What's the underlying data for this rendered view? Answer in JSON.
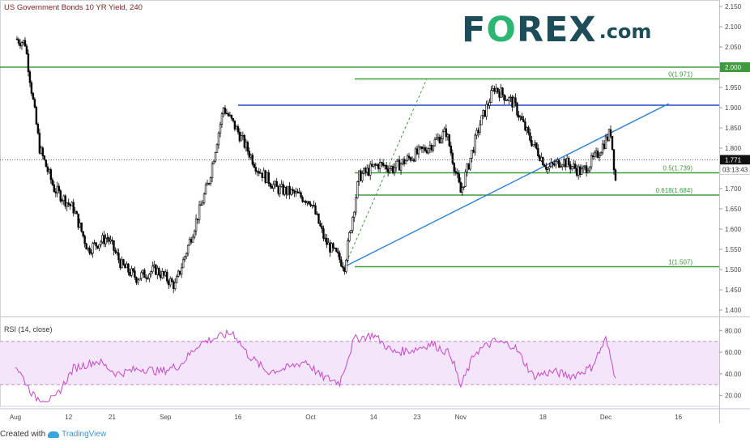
{
  "header": {
    "title": "US Government Bonds 10 YR Yield, 240",
    "logo_text_a": "F",
    "logo_text_o": "O",
    "logo_text_b": "REX",
    "logo_suffix": ".com"
  },
  "footer": {
    "created_with": "Created with",
    "brand": "TradingView"
  },
  "colors": {
    "candle": "#000000",
    "green_line": "#3d9a3d",
    "blue_line": "#2244cc",
    "trend_line": "#2a7fd4",
    "rsi_line": "#cc44cc",
    "rsi_band": "#f3e6fb",
    "rsi_dash": "#c98ccb"
  },
  "chart_data": [
    {
      "type": "candlestick",
      "title": "US Government Bonds 10 YR Yield, 240",
      "ylim": [
        1.39,
        2.15
      ],
      "y_ticks": [
        "2.150",
        "2.100",
        "2.050",
        "2.000",
        "1.950",
        "1.900",
        "1.850",
        "1.800",
        "1.750",
        "1.700",
        "1.650",
        "1.600",
        "1.550",
        "1.500",
        "1.450",
        "1.400"
      ],
      "x_ticks": [
        "Aug",
        "12",
        "21",
        "Sep",
        "16",
        "Oct",
        "14",
        "23",
        "Nov",
        "18",
        "Dec",
        "16"
      ],
      "current_price": "1.771",
      "countdown": "03:13:43",
      "horizontal_levels": [
        {
          "value": 2.0,
          "label": "2.000"
        },
        {
          "value": 1.906
        },
        {
          "value": 1.971,
          "label": "0(1.971)"
        },
        {
          "value": 1.739,
          "label": "0.5(1.739)"
        },
        {
          "value": 1.684,
          "label": "0.618(1.684)"
        },
        {
          "value": 1.507,
          "label": "1(1.507)"
        }
      ],
      "trendline": {
        "from": [
          "Oct 8",
          1.507
        ],
        "to": [
          "Dec 14",
          1.91
        ]
      },
      "approx_path": [
        [
          "Aug 1",
          2.07
        ],
        [
          "Aug 3",
          2.06
        ],
        [
          "Aug 6",
          1.8
        ],
        [
          "Aug 9",
          1.7
        ],
        [
          "Aug 13",
          1.65
        ],
        [
          "Aug 16",
          1.55
        ],
        [
          "Aug 20",
          1.58
        ],
        [
          "Aug 23",
          1.51
        ],
        [
          "Aug 26",
          1.48
        ],
        [
          "Aug 30",
          1.5
        ],
        [
          "Sep 3",
          1.46
        ],
        [
          "Sep 6",
          1.57
        ],
        [
          "Sep 10",
          1.72
        ],
        [
          "Sep 13",
          1.9
        ],
        [
          "Sep 16",
          1.84
        ],
        [
          "Sep 20",
          1.75
        ],
        [
          "Sep 24",
          1.7
        ],
        [
          "Sep 27",
          1.69
        ],
        [
          "Oct 1",
          1.67
        ],
        [
          "Oct 4",
          1.57
        ],
        [
          "Oct 8",
          1.51
        ],
        [
          "Oct 11",
          1.73
        ],
        [
          "Oct 15",
          1.76
        ],
        [
          "Oct 18",
          1.75
        ],
        [
          "Oct 22",
          1.78
        ],
        [
          "Oct 25",
          1.8
        ],
        [
          "Oct 29",
          1.84
        ],
        [
          "Nov 1",
          1.69
        ],
        [
          "Nov 5",
          1.86
        ],
        [
          "Nov 8",
          1.95
        ],
        [
          "Nov 12",
          1.91
        ],
        [
          "Nov 15",
          1.83
        ],
        [
          "Nov 19",
          1.75
        ],
        [
          "Nov 22",
          1.77
        ],
        [
          "Nov 26",
          1.74
        ],
        [
          "Nov 29",
          1.78
        ],
        [
          "Dec 2",
          1.84
        ],
        [
          "Dec 3",
          1.72
        ]
      ]
    },
    {
      "type": "line",
      "title": "RSI (14, close)",
      "ylim": [
        10,
        90
      ],
      "y_ticks": [
        "80.00",
        "60.00",
        "40.00",
        "20.00"
      ],
      "band": [
        30,
        70
      ],
      "approx_path": [
        [
          "Aug 1",
          48
        ],
        [
          "Aug 5",
          18
        ],
        [
          "Aug 9",
          16
        ],
        [
          "Aug 13",
          45
        ],
        [
          "Aug 18",
          52
        ],
        [
          "Aug 22",
          40
        ],
        [
          "Aug 27",
          45
        ],
        [
          "Aug 31",
          42
        ],
        [
          "Sep 4",
          48
        ],
        [
          "Sep 8",
          68
        ],
        [
          "Sep 12",
          74
        ],
        [
          "Sep 15",
          78
        ],
        [
          "Sep 18",
          58
        ],
        [
          "Sep 22",
          42
        ],
        [
          "Sep 26",
          45
        ],
        [
          "Sep 30",
          52
        ],
        [
          "Oct 3",
          38
        ],
        [
          "Oct 7",
          32
        ],
        [
          "Oct 10",
          72
        ],
        [
          "Oct 14",
          76
        ],
        [
          "Oct 18",
          60
        ],
        [
          "Oct 22",
          62
        ],
        [
          "Oct 26",
          68
        ],
        [
          "Oct 30",
          58
        ],
        [
          "Nov 1",
          28
        ],
        [
          "Nov 4",
          60
        ],
        [
          "Nov 8",
          70
        ],
        [
          "Nov 12",
          66
        ],
        [
          "Nov 16",
          38
        ],
        [
          "Nov 20",
          42
        ],
        [
          "Nov 24",
          38
        ],
        [
          "Nov 28",
          46
        ],
        [
          "Dec 1",
          72
        ],
        [
          "Dec 3",
          36
        ]
      ]
    }
  ]
}
